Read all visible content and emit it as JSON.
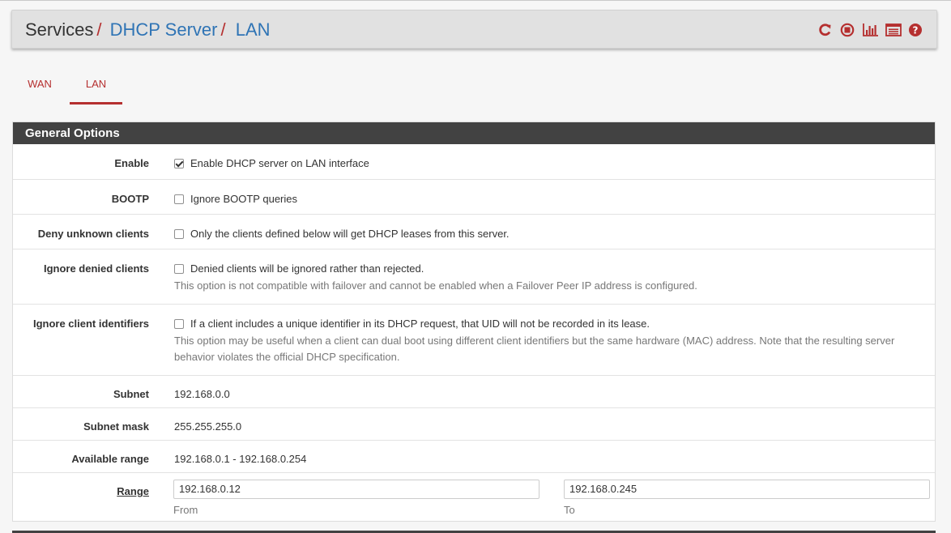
{
  "breadcrumb": {
    "items": [
      "Services",
      "DHCP Server",
      "LAN"
    ],
    "separator": "/"
  },
  "header_icons": [
    "restart-service-icon",
    "stop-service-icon",
    "status-chart-icon",
    "log-list-icon",
    "help-icon"
  ],
  "tabs": [
    {
      "label": "WAN",
      "active": false
    },
    {
      "label": "LAN",
      "active": true
    }
  ],
  "section_title": "General Options",
  "options": {
    "enable": {
      "label": "Enable",
      "text": "Enable DHCP server on LAN interface",
      "checked": true
    },
    "bootp": {
      "label": "BOOTP",
      "text": "Ignore BOOTP queries",
      "checked": false
    },
    "deny_unknown": {
      "label": "Deny unknown clients",
      "text": "Only the clients defined below will get DHCP leases from this server.",
      "checked": false
    },
    "ignore_denied": {
      "label": "Ignore denied clients",
      "text": "Denied clients will be ignored rather than rejected.",
      "help": "This option is not compatible with failover and cannot be enabled when a Failover Peer IP address is configured.",
      "checked": false
    },
    "ignore_client_ids": {
      "label": "Ignore client identifiers",
      "text": "If a client includes a unique identifier in its DHCP request, that UID will not be recorded in its lease.",
      "help": "This option may be useful when a client can dual boot using different client identifiers but the same hardware (MAC) address. Note that the resulting server behavior violates the official DHCP specification.",
      "checked": false
    }
  },
  "subnet": {
    "label": "Subnet",
    "value": "192.168.0.0"
  },
  "subnet_mask": {
    "label": "Subnet mask",
    "value": "255.255.255.0"
  },
  "available_range": {
    "label": "Available range",
    "value": "192.168.0.1 - 192.168.0.254"
  },
  "range": {
    "label": "Range",
    "from_value": "192.168.0.12",
    "from_label": "From",
    "to_value": "192.168.0.245",
    "to_label": "To"
  },
  "colors": {
    "accent": "#b52f2f",
    "link": "#2f74b5",
    "panel_header": "#424242"
  }
}
